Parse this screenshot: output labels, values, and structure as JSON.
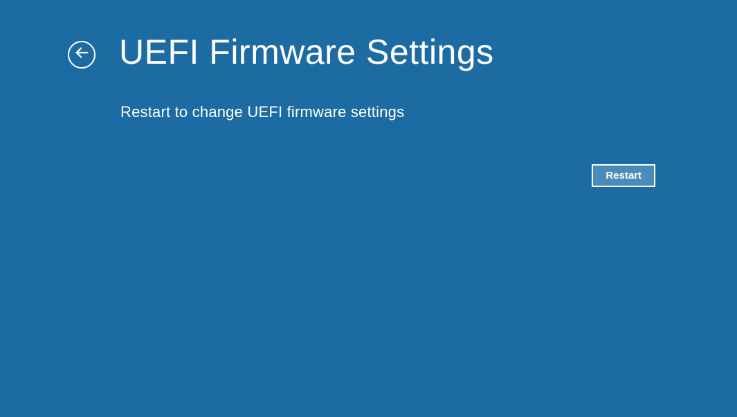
{
  "header": {
    "title": "UEFI Firmware Settings"
  },
  "main": {
    "description": "Restart to change UEFI firmware settings"
  },
  "actions": {
    "restart_label": "Restart"
  }
}
